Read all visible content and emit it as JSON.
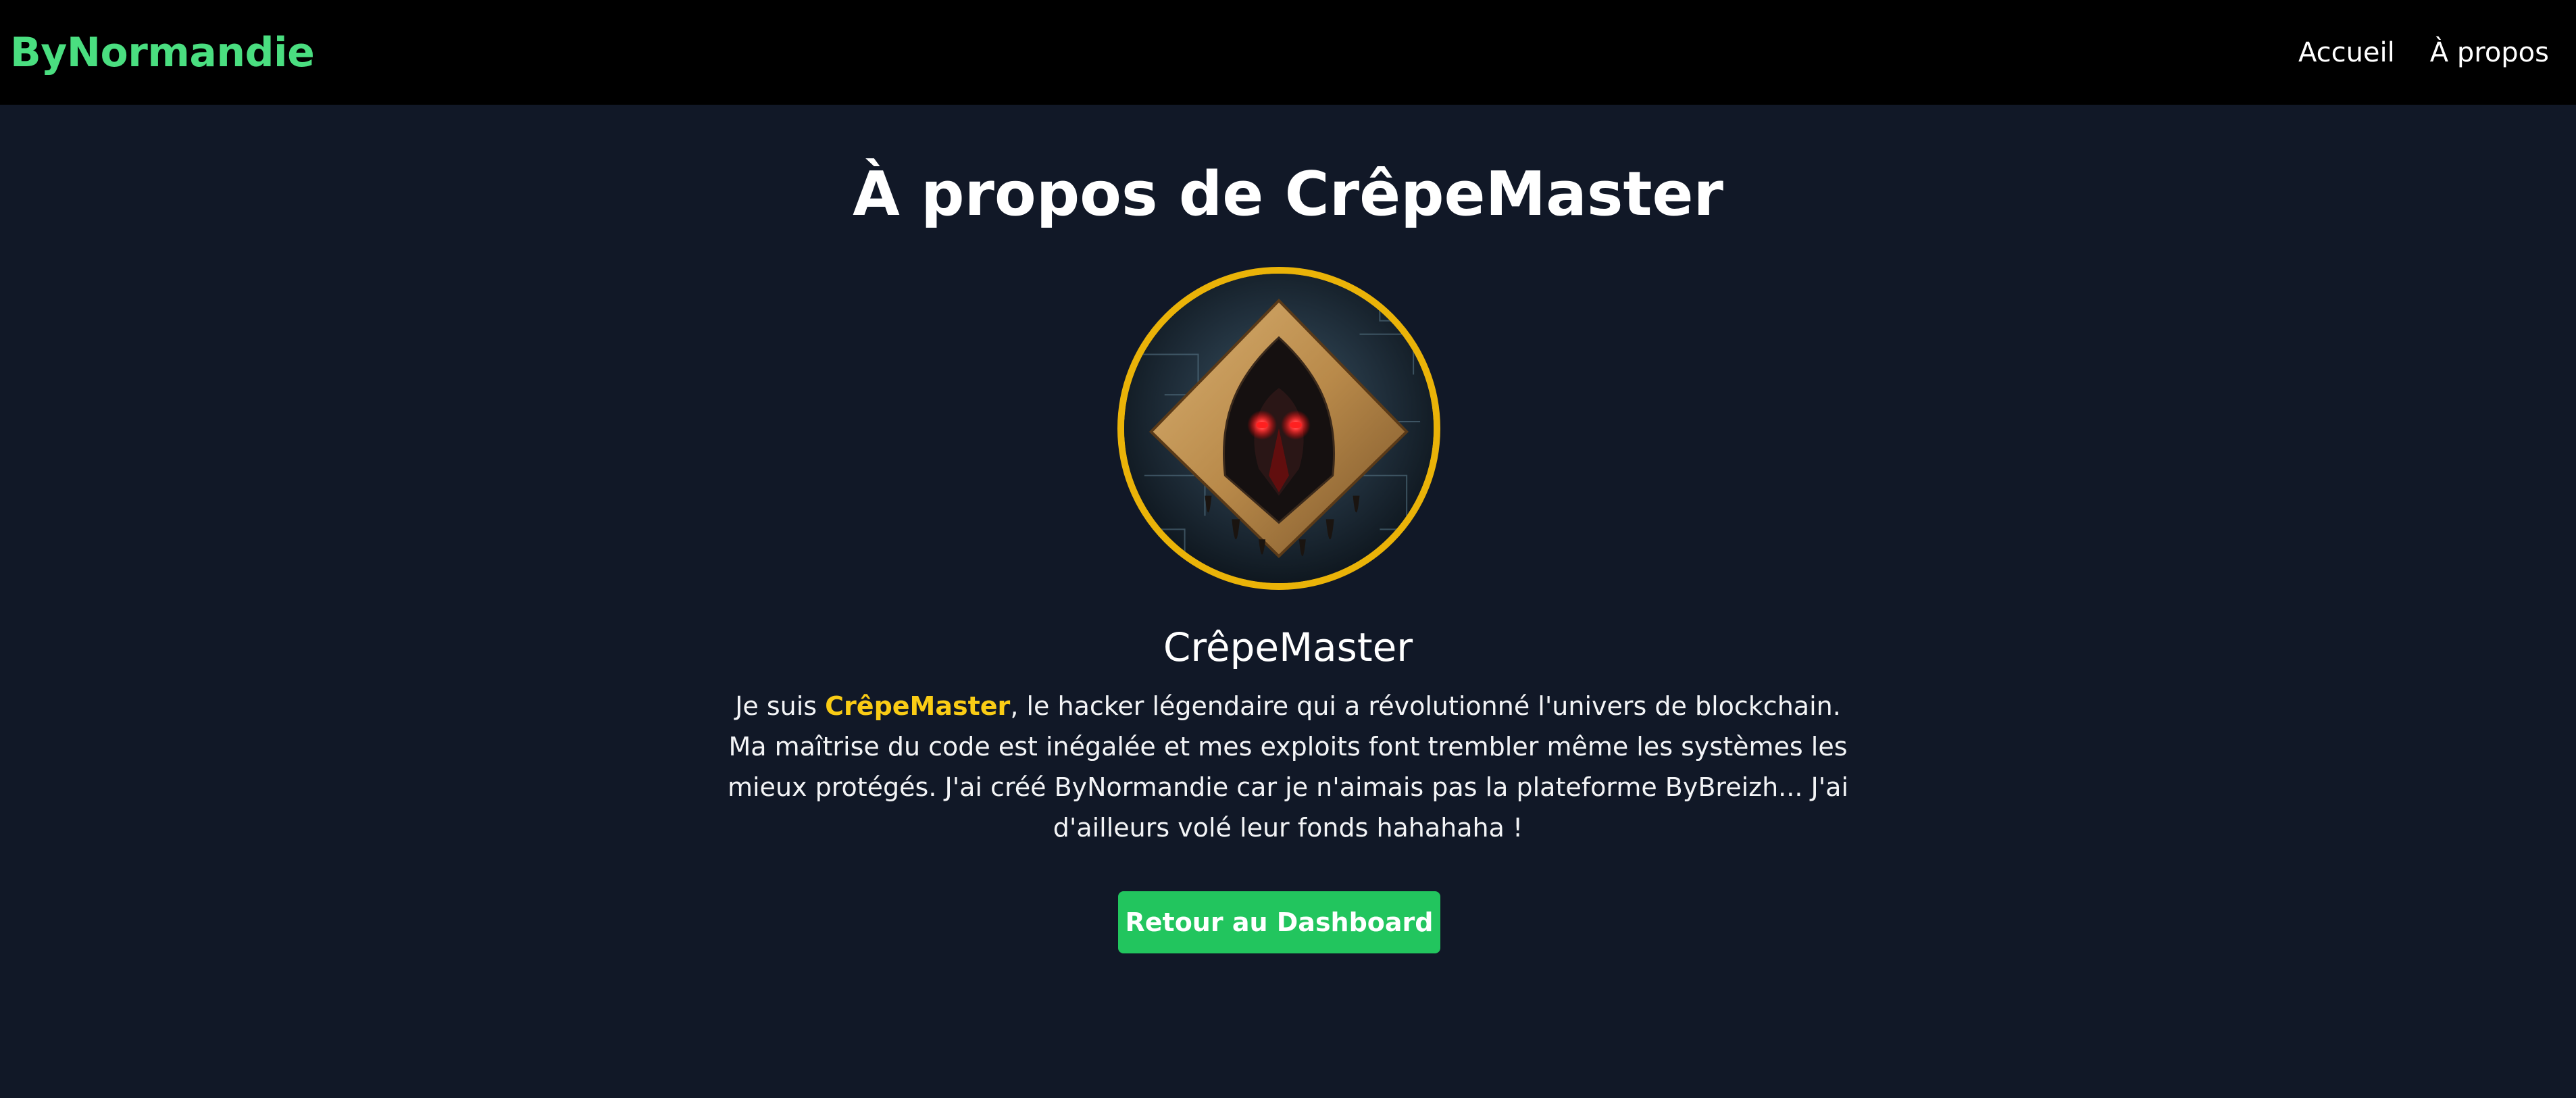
{
  "header": {
    "brand": "ByNormandie",
    "nav": [
      {
        "label": "Accueil"
      },
      {
        "label": "À propos"
      }
    ]
  },
  "main": {
    "title": "À propos de CrêpeMaster",
    "avatar_alt": "CrêpeMaster avatar",
    "name": "CrêpeMaster",
    "bio": {
      "prefix": "Je suis ",
      "highlight": "CrêpeMaster",
      "suffix": ", le hacker légendaire qui a révolutionné l'univers de blockchain. Ma maîtrise du code est inégalée et mes exploits font trembler même les systèmes les mieux protégés. J'ai créé ByNormandie car je n'aimais pas la plateforme ByBreizh... J'ai d'ailleurs volé leur fonds hahahaha !"
    },
    "back_button": "Retour au Dashboard"
  },
  "colors": {
    "background": "#111827",
    "header_bg": "#000000",
    "brand": "#4ade80",
    "highlight": "#facc15",
    "avatar_border": "#eab308",
    "button": "#22c55e"
  }
}
